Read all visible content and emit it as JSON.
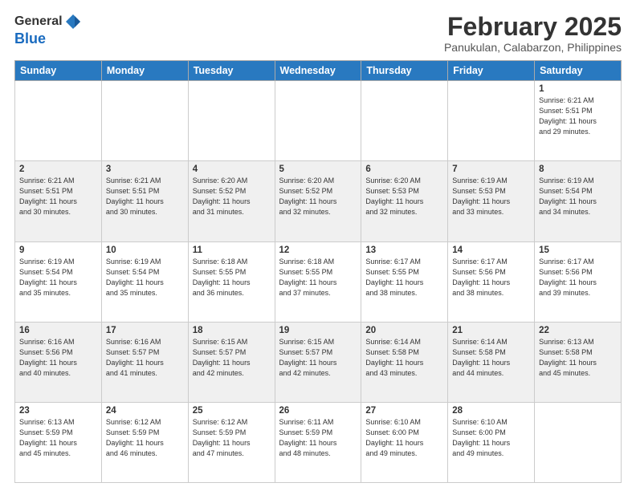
{
  "header": {
    "logo_general": "General",
    "logo_blue": "Blue",
    "title": "February 2025",
    "subtitle": "Panukulan, Calabarzon, Philippines"
  },
  "days_of_week": [
    "Sunday",
    "Monday",
    "Tuesday",
    "Wednesday",
    "Thursday",
    "Friday",
    "Saturday"
  ],
  "weeks": [
    {
      "cells": [
        {
          "day": "",
          "info": ""
        },
        {
          "day": "",
          "info": ""
        },
        {
          "day": "",
          "info": ""
        },
        {
          "day": "",
          "info": ""
        },
        {
          "day": "",
          "info": ""
        },
        {
          "day": "",
          "info": ""
        },
        {
          "day": "1",
          "info": "Sunrise: 6:21 AM\nSunset: 5:51 PM\nDaylight: 11 hours\nand 29 minutes."
        }
      ]
    },
    {
      "cells": [
        {
          "day": "2",
          "info": "Sunrise: 6:21 AM\nSunset: 5:51 PM\nDaylight: 11 hours\nand 30 minutes."
        },
        {
          "day": "3",
          "info": "Sunrise: 6:21 AM\nSunset: 5:51 PM\nDaylight: 11 hours\nand 30 minutes."
        },
        {
          "day": "4",
          "info": "Sunrise: 6:20 AM\nSunset: 5:52 PM\nDaylight: 11 hours\nand 31 minutes."
        },
        {
          "day": "5",
          "info": "Sunrise: 6:20 AM\nSunset: 5:52 PM\nDaylight: 11 hours\nand 32 minutes."
        },
        {
          "day": "6",
          "info": "Sunrise: 6:20 AM\nSunset: 5:53 PM\nDaylight: 11 hours\nand 32 minutes."
        },
        {
          "day": "7",
          "info": "Sunrise: 6:19 AM\nSunset: 5:53 PM\nDaylight: 11 hours\nand 33 minutes."
        },
        {
          "day": "8",
          "info": "Sunrise: 6:19 AM\nSunset: 5:54 PM\nDaylight: 11 hours\nand 34 minutes."
        }
      ]
    },
    {
      "cells": [
        {
          "day": "9",
          "info": "Sunrise: 6:19 AM\nSunset: 5:54 PM\nDaylight: 11 hours\nand 35 minutes."
        },
        {
          "day": "10",
          "info": "Sunrise: 6:19 AM\nSunset: 5:54 PM\nDaylight: 11 hours\nand 35 minutes."
        },
        {
          "day": "11",
          "info": "Sunrise: 6:18 AM\nSunset: 5:55 PM\nDaylight: 11 hours\nand 36 minutes."
        },
        {
          "day": "12",
          "info": "Sunrise: 6:18 AM\nSunset: 5:55 PM\nDaylight: 11 hours\nand 37 minutes."
        },
        {
          "day": "13",
          "info": "Sunrise: 6:17 AM\nSunset: 5:55 PM\nDaylight: 11 hours\nand 38 minutes."
        },
        {
          "day": "14",
          "info": "Sunrise: 6:17 AM\nSunset: 5:56 PM\nDaylight: 11 hours\nand 38 minutes."
        },
        {
          "day": "15",
          "info": "Sunrise: 6:17 AM\nSunset: 5:56 PM\nDaylight: 11 hours\nand 39 minutes."
        }
      ]
    },
    {
      "cells": [
        {
          "day": "16",
          "info": "Sunrise: 6:16 AM\nSunset: 5:56 PM\nDaylight: 11 hours\nand 40 minutes."
        },
        {
          "day": "17",
          "info": "Sunrise: 6:16 AM\nSunset: 5:57 PM\nDaylight: 11 hours\nand 41 minutes."
        },
        {
          "day": "18",
          "info": "Sunrise: 6:15 AM\nSunset: 5:57 PM\nDaylight: 11 hours\nand 42 minutes."
        },
        {
          "day": "19",
          "info": "Sunrise: 6:15 AM\nSunset: 5:57 PM\nDaylight: 11 hours\nand 42 minutes."
        },
        {
          "day": "20",
          "info": "Sunrise: 6:14 AM\nSunset: 5:58 PM\nDaylight: 11 hours\nand 43 minutes."
        },
        {
          "day": "21",
          "info": "Sunrise: 6:14 AM\nSunset: 5:58 PM\nDaylight: 11 hours\nand 44 minutes."
        },
        {
          "day": "22",
          "info": "Sunrise: 6:13 AM\nSunset: 5:58 PM\nDaylight: 11 hours\nand 45 minutes."
        }
      ]
    },
    {
      "cells": [
        {
          "day": "23",
          "info": "Sunrise: 6:13 AM\nSunset: 5:59 PM\nDaylight: 11 hours\nand 45 minutes."
        },
        {
          "day": "24",
          "info": "Sunrise: 6:12 AM\nSunset: 5:59 PM\nDaylight: 11 hours\nand 46 minutes."
        },
        {
          "day": "25",
          "info": "Sunrise: 6:12 AM\nSunset: 5:59 PM\nDaylight: 11 hours\nand 47 minutes."
        },
        {
          "day": "26",
          "info": "Sunrise: 6:11 AM\nSunset: 5:59 PM\nDaylight: 11 hours\nand 48 minutes."
        },
        {
          "day": "27",
          "info": "Sunrise: 6:10 AM\nSunset: 6:00 PM\nDaylight: 11 hours\nand 49 minutes."
        },
        {
          "day": "28",
          "info": "Sunrise: 6:10 AM\nSunset: 6:00 PM\nDaylight: 11 hours\nand 49 minutes."
        },
        {
          "day": "",
          "info": ""
        }
      ]
    }
  ]
}
